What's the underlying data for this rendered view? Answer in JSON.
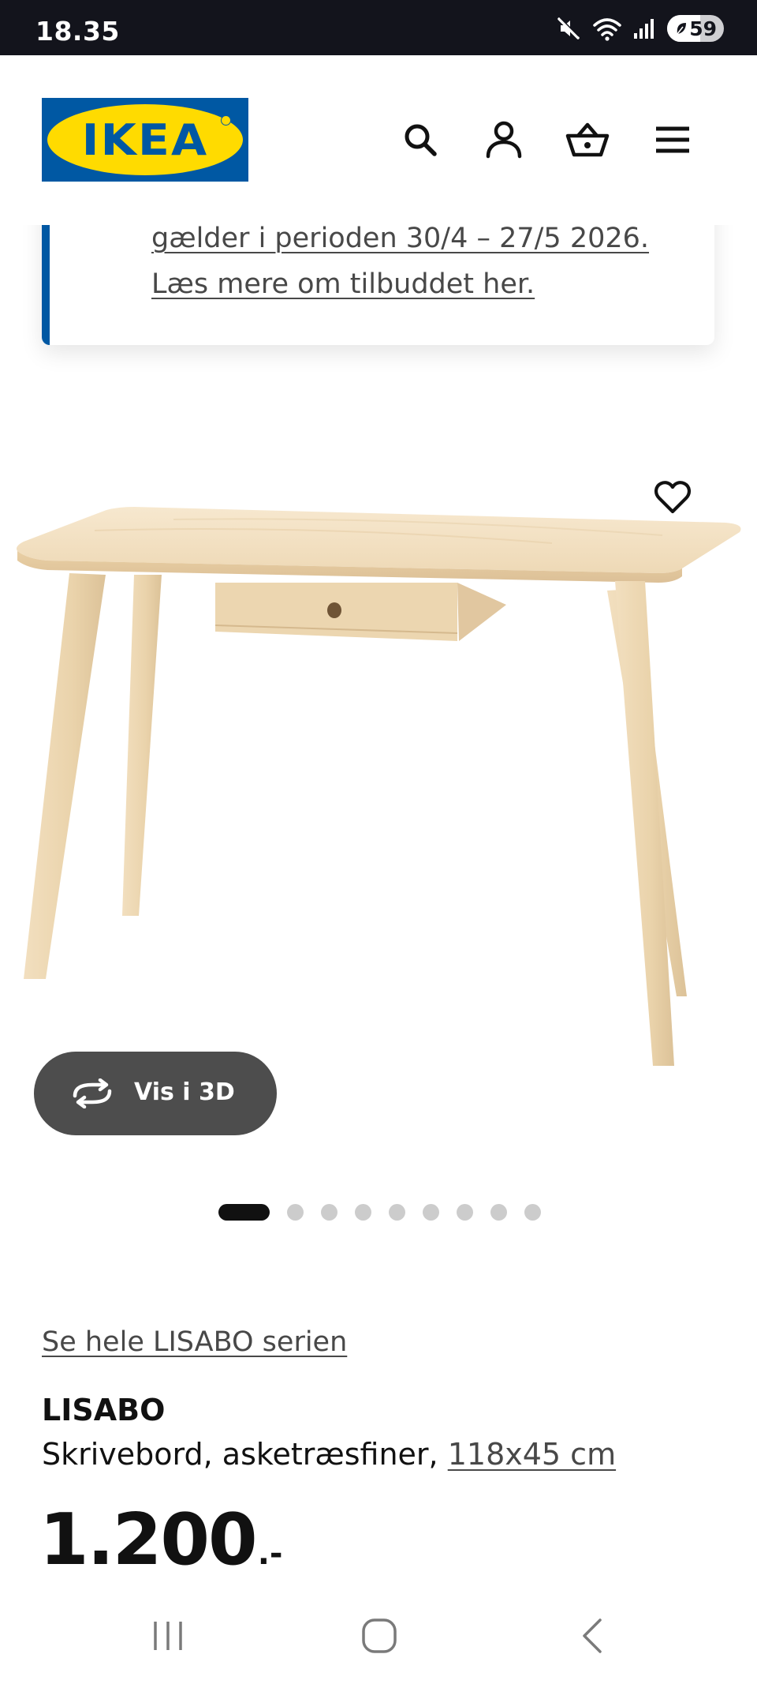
{
  "status_bar": {
    "time": "18.35",
    "battery_percent": "59",
    "battery_level": 0.59,
    "icons": [
      "mute-icon",
      "wifi-icon",
      "signal-icon",
      "battery-icon"
    ]
  },
  "header": {
    "logo_text": "IKEA",
    "icons": [
      "search-icon",
      "profile-icon",
      "basket-icon",
      "menu-icon"
    ]
  },
  "promo": {
    "line1": "gælder i perioden 30/4 – 27/5 2026.",
    "line2": "Læs mere om tilbuddet her."
  },
  "product": {
    "view_3d_label": "Vis i 3D",
    "carousel": {
      "total": 9,
      "active_index": 0
    },
    "series_link": "Se hele LISABO serien",
    "name": "LISABO",
    "description": "Skrivebord, asketræsfiner, ",
    "size": "118x45 cm",
    "price": "1.200",
    "price_suffix": ".-"
  },
  "nav_bar": {
    "icons": [
      "recent-apps-icon",
      "home-icon",
      "back-icon"
    ]
  },
  "colors": {
    "ikea_blue": "#0058a3",
    "ikea_yellow": "#ffdb00",
    "status_bar_bg": "#13141c",
    "button_dark": "#4d4d4d",
    "link_gray": "#484848"
  }
}
